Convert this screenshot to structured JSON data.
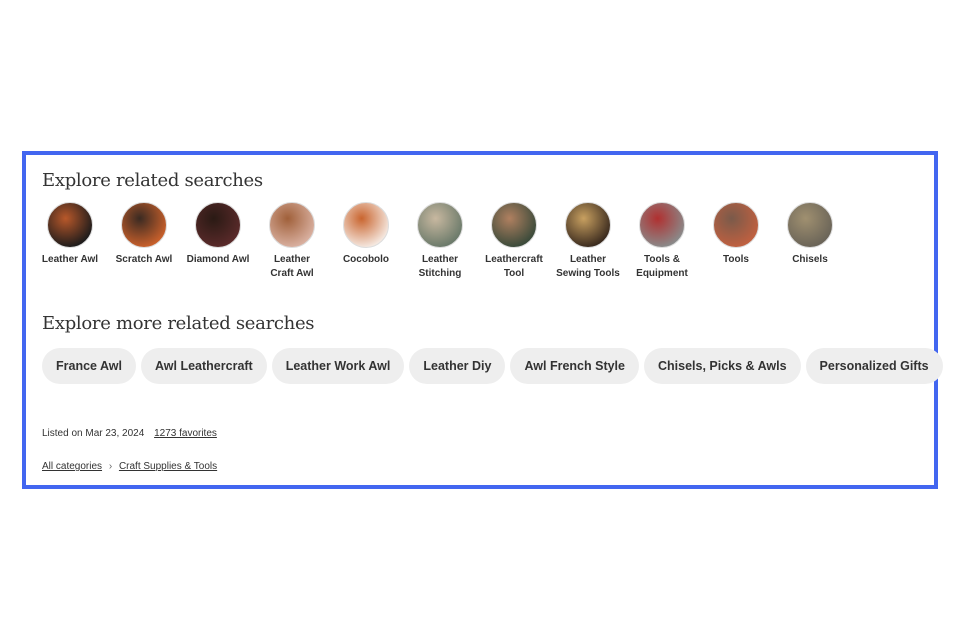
{
  "section1": {
    "title": "Explore related searches",
    "items": [
      {
        "label": "Leather Awl",
        "colors": [
          "#1d1b1b",
          "#b8582a"
        ]
      },
      {
        "label": "Scratch Awl",
        "colors": [
          "#c9602b",
          "#3a2a22"
        ]
      },
      {
        "label": "Diamond Awl",
        "colors": [
          "#5a2a2a",
          "#2a1a14"
        ]
      },
      {
        "label": "Leather Craft Awl",
        "colors": [
          "#d9b0a0",
          "#a0603a"
        ]
      },
      {
        "label": "Cocobolo",
        "colors": [
          "#f5e8e0",
          "#c9652f"
        ]
      },
      {
        "label": "Leather Stitching",
        "colors": [
          "#6b7a6a",
          "#c8b8a0"
        ]
      },
      {
        "label": "Leathercraft Tool",
        "colors": [
          "#3a4a3a",
          "#b08060"
        ]
      },
      {
        "label": "Leather Sewing Tools",
        "colors": [
          "#3a2a1e",
          "#c8a060"
        ]
      },
      {
        "label": "Tools & Equipment",
        "colors": [
          "#8a8a8a",
          "#b03030"
        ]
      },
      {
        "label": "Tools",
        "colors": [
          "#c06040",
          "#7a5a4a"
        ]
      },
      {
        "label": "Chisels",
        "colors": [
          "#6a6458",
          "#a09070"
        ]
      }
    ]
  },
  "section2": {
    "title": "Explore more related searches",
    "pills": [
      "France Awl",
      "Awl Leathercraft",
      "Leather Work Awl",
      "Leather Diy",
      "Awl French Style",
      "Chisels, Picks & Awls",
      "Personalized Gifts"
    ]
  },
  "meta": {
    "listed": "Listed on Mar 23, 2024",
    "favorites": "1273 favorites"
  },
  "breadcrumb": {
    "items": [
      "All categories",
      "Craft Supplies & Tools"
    ],
    "separator_icon": "chevron-right-icon"
  },
  "colors": {
    "frame": "#4266f0",
    "pill_bg": "#eeeeee"
  }
}
